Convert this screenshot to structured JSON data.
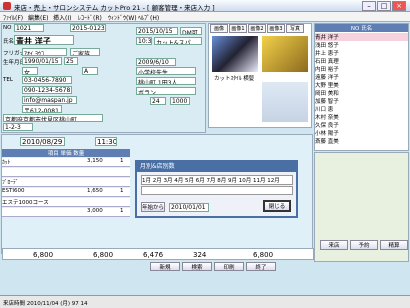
{
  "title": "来店・売上・サロンシステム カットPro 21 - [ 顧客管理・来店入力 ]",
  "menu": [
    "ﾌｧｲﾙ(F)",
    "編集(E)",
    "挿入(I)",
    "ﾚｺｰﾄﾞ(R)",
    "ｳｨﾝﾄﾞｳ(W)",
    "ﾍﾙﾌﾟ(H)"
  ],
  "customer": {
    "no_label": "NO",
    "no": "1021",
    "reg_no": "2015-0123",
    "name_label": "氏名",
    "name": "青井 洋子",
    "kana_label": "フリガナ",
    "kana": "ｱｵｲ ﾖｳｺ",
    "kana2": "ご家族",
    "birth_label": "生年月日",
    "birth": "1990/01/15",
    "age": "25",
    "sex": "女",
    "gender": "A",
    "blood": "A",
    "tel_label": "TEL",
    "tel": "03-0456-7890",
    "mobile": "090-1234-5678",
    "email": "info@maspan.jp",
    "zip": "〒612-0081",
    "address": "京都府京都市伏見区桃山町",
    "addr2": "1-2-3",
    "first_visit": "2015/10/15",
    "dm": "DM可",
    "time": "10:30",
    "stylist": "カット&スパ",
    "occupation": "小学校先生",
    "hometown": "桃山町 1田3人",
    "intro": "2009/6/10",
    "hobby": "ボラン",
    "count": "24",
    "memo": "1000",
    "ticket": "ﾁｹｯﾄ"
  },
  "photo_tabs": [
    "画像",
    "画像1",
    "画像2",
    "画像3",
    "写真"
  ],
  "photo_caption": "カットｽﾀｲﾙ 横髪",
  "visit_date": "2010/08/29",
  "visit_time": "11:30",
  "items": [
    {
      "name": "ｶｯﾄ",
      "price": "3,150",
      "qty": "1"
    },
    {
      "name": "",
      "price": "",
      "qty": ""
    },
    {
      "name": "ﾌﾞﾛｰﾃﾞ",
      "price": "",
      "qty": ""
    },
    {
      "name": "ESTI600",
      "price": "1,650",
      "qty": "1"
    },
    {
      "name": "エステ1000コース",
      "price": "",
      "qty": ""
    },
    {
      "name": "",
      "price": "3,000",
      "qty": "1"
    }
  ],
  "modal": {
    "title": "月別&店別数",
    "months": [
      "1月",
      "2月",
      "3月",
      "4月",
      "5月",
      "6月",
      "7月",
      "8月",
      "9月",
      "10月",
      "11月",
      "12月"
    ],
    "from_btn": "年始から",
    "date": "2010/01/01",
    "close": "閉じる"
  },
  "totals": {
    "a": "6,800",
    "b": "6,800",
    "c": "6,476",
    "d": "324",
    "e": "6,800"
  },
  "names": [
    "青井 洋子",
    "浅田 悠子",
    "井上 恵子",
    "石田 真理",
    "内田 裕子",
    "遠藤 洋子",
    "大野 里美",
    "岡田 美和",
    "加藤 智子",
    "川口 恵",
    "木村 奈美",
    "久保 良子",
    "小林 陽子",
    "斎藤 直美",
    "佐藤 由美",
    "清水 和子"
  ],
  "bottom": [
    "新規",
    "検索",
    "印刷",
    "終了"
  ],
  "right_btns": [
    "来店",
    "予約",
    "精算"
  ],
  "status": "来店時間 2010/11/04 (月) 97 14"
}
